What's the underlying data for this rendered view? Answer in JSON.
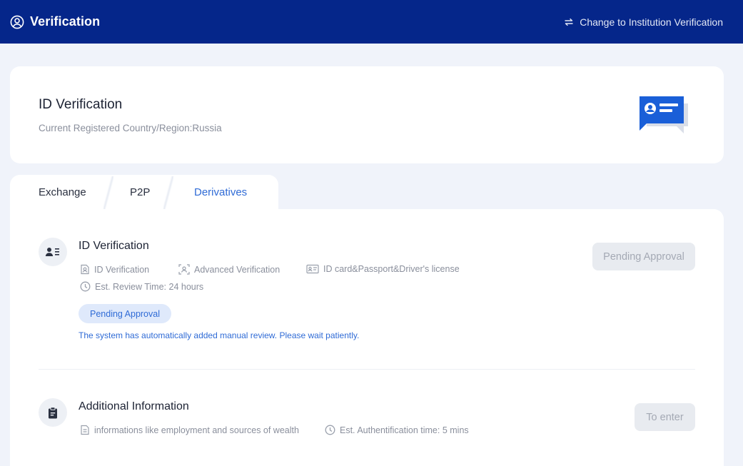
{
  "header": {
    "title": "Verification",
    "switch_label": "Change to Institution Verification"
  },
  "id_card": {
    "title": "ID Verification",
    "subtitle": "Current Registered Country/Region:Russia"
  },
  "tabs": [
    {
      "label": "Exchange",
      "active": false
    },
    {
      "label": "P2P",
      "active": false
    },
    {
      "label": "Derivatives",
      "active": true
    }
  ],
  "sections": {
    "id_verification": {
      "title": "ID Verification",
      "features": [
        "ID Verification",
        "Advanced Verification",
        "ID card&Passport&Driver's license"
      ],
      "review_time": "Est. Review Time: 24 hours",
      "button_label": "Pending Approval",
      "status_badge": "Pending Approval",
      "note": "The system has automatically added manual review. Please wait patiently."
    },
    "additional_info": {
      "title": "Additional Information",
      "description": "informations like employment and sources of wealth",
      "auth_time": "Est. Authentification time: 5 mins",
      "button_label": "To enter"
    }
  },
  "colors": {
    "header_bg": "#05268a",
    "accent": "#2f6bd6",
    "page_bg": "#f0f3fa"
  },
  "icons": [
    "user-circle-icon",
    "swap-icon",
    "id-card-illustration",
    "user-list-icon",
    "id-document-icon",
    "face-scan-icon",
    "license-card-icon",
    "clock-icon",
    "clipboard-icon",
    "file-text-icon"
  ]
}
